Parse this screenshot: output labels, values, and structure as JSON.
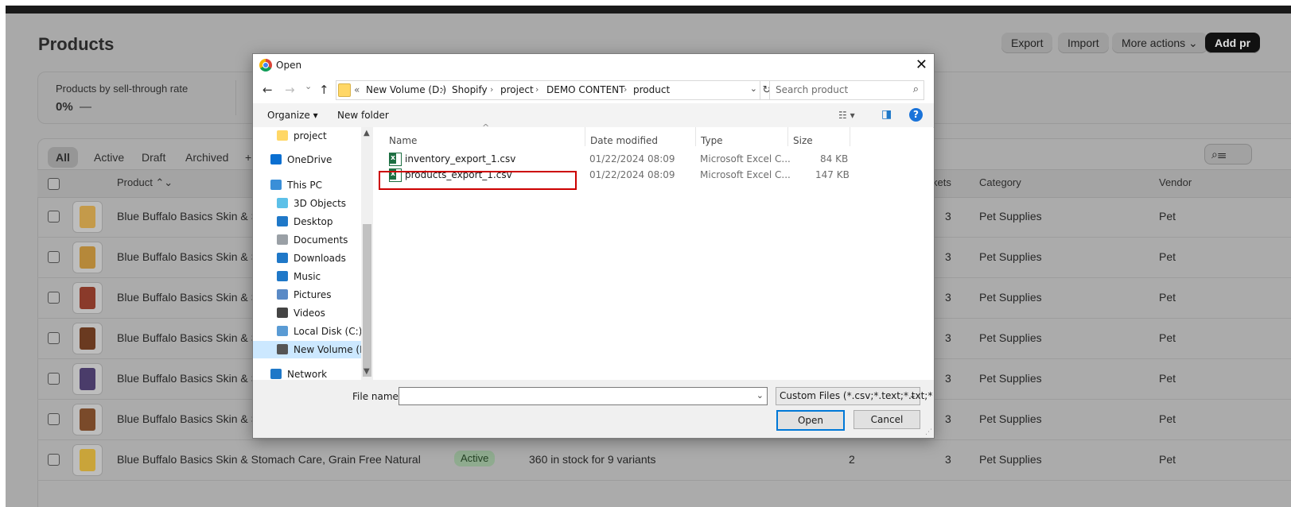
{
  "page": {
    "title": "Products",
    "actions": {
      "export": "Export",
      "import": "Import",
      "more": "More actions ⌄",
      "add": "Add pr"
    },
    "stats": {
      "label": "Products by sell-through rate",
      "value": "0%",
      "dash": "—"
    },
    "tabs": [
      "All",
      "Active",
      "Draft",
      "Archived",
      "+"
    ],
    "search_icon": "⌕☰",
    "headers": {
      "product": "Product ⌃⌄",
      "markets": "kets",
      "category": "Category",
      "vendor": "Vendor"
    },
    "rows": [
      {
        "name": "Blue Buffalo Basics Skin & St",
        "markets": "3",
        "category": "Pet Supplies",
        "vendor": "Pet",
        "thumb_color": "#c49a4a"
      },
      {
        "name": "Blue Buffalo Basics Skin & St",
        "markets": "3",
        "category": "Pet Supplies",
        "vendor": "Pet",
        "thumb_color": "#b5883a"
      },
      {
        "name": "Blue Buffalo Basics Skin & St",
        "markets": "3",
        "category": "Pet Supplies",
        "vendor": "Pet",
        "thumb_color": "#8a3a2a"
      },
      {
        "name": "Blue Buffalo Basics Skin & St",
        "markets": "3",
        "category": "Pet Supplies",
        "vendor": "Pet",
        "thumb_color": "#6a3a20"
      },
      {
        "name": "Blue Buffalo Basics Skin & St",
        "markets": "3",
        "category": "Pet Supplies",
        "vendor": "Pet",
        "thumb_color": "#4a3c6a"
      },
      {
        "name": "Blue Buffalo Basics Skin & St",
        "markets": "3",
        "category": "Pet Supplies",
        "vendor": "Pet",
        "thumb_color": "#7a4a2a"
      },
      {
        "name": "Blue Buffalo Basics Skin & Stomach Care, Grain Free Natural",
        "status": "Active",
        "inventory": "360 in stock for 9 variants",
        "sales_channels": "2",
        "markets": "3",
        "category": "Pet Supplies",
        "vendor": "Pet",
        "thumb_color": "#c9a43a"
      }
    ]
  },
  "dialog": {
    "title": "Open",
    "close": "✕",
    "nav": {
      "back": "←",
      "forward": "→",
      "recent": "⌄",
      "up": "↑"
    },
    "address": {
      "prefix": "«",
      "crumbs": [
        "New Volume (D:)",
        "Shopify",
        "project",
        "DEMO CONTENT",
        "product"
      ],
      "sep": "›",
      "dropdown": "⌄",
      "refresh": "↻"
    },
    "search": {
      "placeholder": "Search product",
      "icon": "⌕"
    },
    "toolbar": {
      "organize": "Organize ▾",
      "new_folder": "New folder",
      "view": "☷ ▾",
      "pane": "◨",
      "help": "?"
    },
    "nav_pane": [
      {
        "label": "project",
        "icon": "folder-icon",
        "color": "#ffd766"
      },
      {
        "label": "OneDrive",
        "icon": "cloud-icon",
        "color": "#0a6fd1"
      },
      {
        "label": "This PC",
        "icon": "computer-icon",
        "color": "#3a8fd8"
      },
      {
        "label": "3D Objects",
        "icon": "cube-icon",
        "color": "#5cc0e8"
      },
      {
        "label": "Desktop",
        "icon": "desktop-icon",
        "color": "#1f78c8"
      },
      {
        "label": "Documents",
        "icon": "document-icon",
        "color": "#9aa0a6"
      },
      {
        "label": "Downloads",
        "icon": "download-icon",
        "color": "#1f78c8"
      },
      {
        "label": "Music",
        "icon": "music-icon",
        "color": "#1f78c8"
      },
      {
        "label": "Pictures",
        "icon": "pictures-icon",
        "color": "#5a8ac6"
      },
      {
        "label": "Videos",
        "icon": "video-icon",
        "color": "#444444"
      },
      {
        "label": "Local Disk (C:)",
        "icon": "disk-icon",
        "color": "#5a9bd4"
      },
      {
        "label": "New Volume (D:",
        "icon": "drive-icon",
        "color": "#555555"
      },
      {
        "label": "Network",
        "icon": "network-icon",
        "color": "#1f78c8"
      }
    ],
    "columns": {
      "name": "Name",
      "date": "Date modified",
      "type": "Type",
      "size": "Size",
      "sort": "^"
    },
    "files": [
      {
        "name": "inventory_export_1.csv",
        "date": "01/22/2024 08:09",
        "type": "Microsoft Excel C...",
        "size": "84 KB"
      },
      {
        "name": "products_export_1.csv",
        "date": "01/22/2024 08:09",
        "type": "Microsoft Excel C...",
        "size": "147 KB"
      }
    ],
    "file_name_label": "File name:",
    "file_name_value": "",
    "file_type": "Custom Files (*.csv;*.text;*.txt;*",
    "open": "Open",
    "cancel": "Cancel"
  }
}
